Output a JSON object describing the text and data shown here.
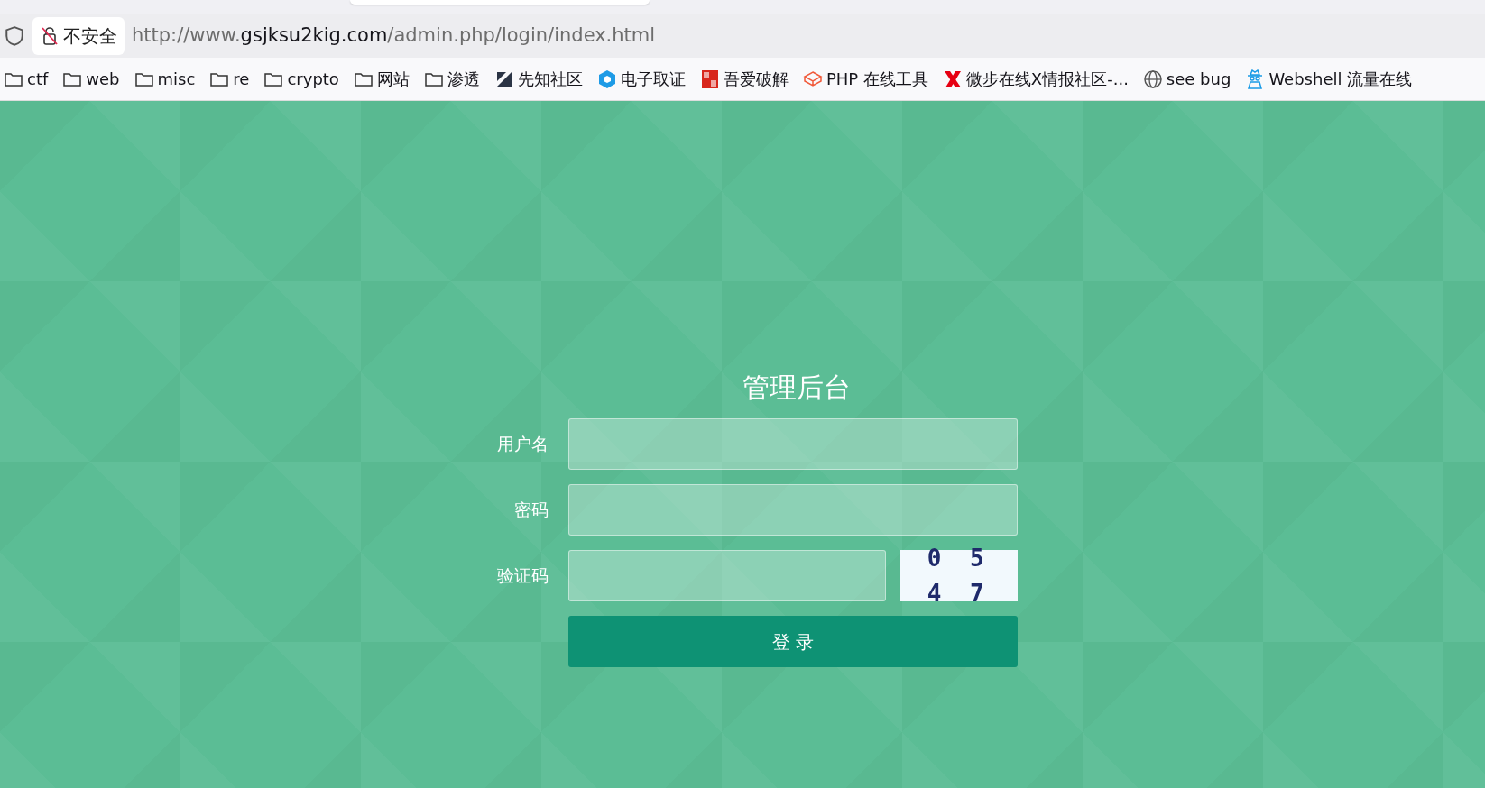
{
  "address_bar": {
    "security_label": "不安全",
    "url": {
      "before": "http://www.",
      "host": "gsjksu2kig.com",
      "after": "/admin.php/login/index.html"
    }
  },
  "bookmarks": [
    {
      "kind": "folder",
      "label": "ctf"
    },
    {
      "kind": "folder",
      "label": "web"
    },
    {
      "kind": "folder",
      "label": "misc"
    },
    {
      "kind": "folder",
      "label": "re"
    },
    {
      "kind": "folder",
      "label": "crypto"
    },
    {
      "kind": "folder",
      "label": "网站"
    },
    {
      "kind": "folder",
      "label": "渗透"
    },
    {
      "kind": "slash",
      "label": "先知社区"
    },
    {
      "kind": "cube",
      "label": "电子取证"
    },
    {
      "kind": "stamp",
      "label": "吾爱破解"
    },
    {
      "kind": "box",
      "label": "PHP 在线工具"
    },
    {
      "kind": "x",
      "label": "微步在线X情报社区-..."
    },
    {
      "kind": "globe",
      "label": "see bug"
    },
    {
      "kind": "spy",
      "label": "Webshell 流量在线"
    }
  ],
  "login": {
    "title": "管理后台",
    "fields": [
      {
        "kind": "text",
        "label": "用户名"
      },
      {
        "kind": "password",
        "label": "密码"
      },
      {
        "kind": "captcha",
        "label": "验证码",
        "captcha": "0 5 4 7"
      }
    ],
    "submit": "登 录"
  }
}
